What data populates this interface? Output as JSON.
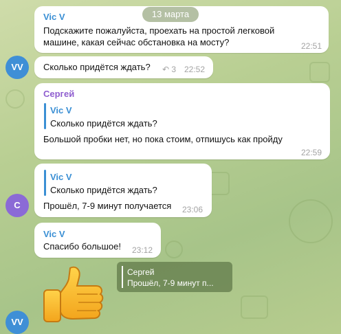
{
  "date_pill": "13 марта",
  "avatars": {
    "vv": "VV",
    "c": "С"
  },
  "messages": [
    {
      "sender": "Vic V",
      "line1": "Подскажите пожалуйста, проехать на простой легковой",
      "line2": "машине, какая сейчас обстановка на мосту?",
      "time": "22:51"
    },
    {
      "text": "Сколько придётся ждать?",
      "reply_count": "3",
      "time": "22:52"
    },
    {
      "sender": "Сергей",
      "quote_name": "Vic V",
      "quote_text": "Сколько придётся ждать?",
      "text": "Большой пробки нет, но пока стоим, отпишусь как пройду",
      "time": "22:59"
    },
    {
      "quote_name": "Vic V",
      "quote_text": "Сколько придётся ждать?",
      "text": "Прошёл, 7-9 минут получается",
      "time": "23:06"
    },
    {
      "sender": "Vic V",
      "text": "Спасибо большое!",
      "time": "23:12"
    }
  ],
  "reply_preview": {
    "name": "Сергей",
    "snippet": "Прошёл, 7-9 минут п..."
  },
  "sticker": "thumbs-up",
  "colors": {
    "blue_name": "#3a8fd4",
    "purple_name": "#8f5ecf",
    "avatar_vv": "#3f8fd6",
    "avatar_c": "#8b6ad6"
  }
}
